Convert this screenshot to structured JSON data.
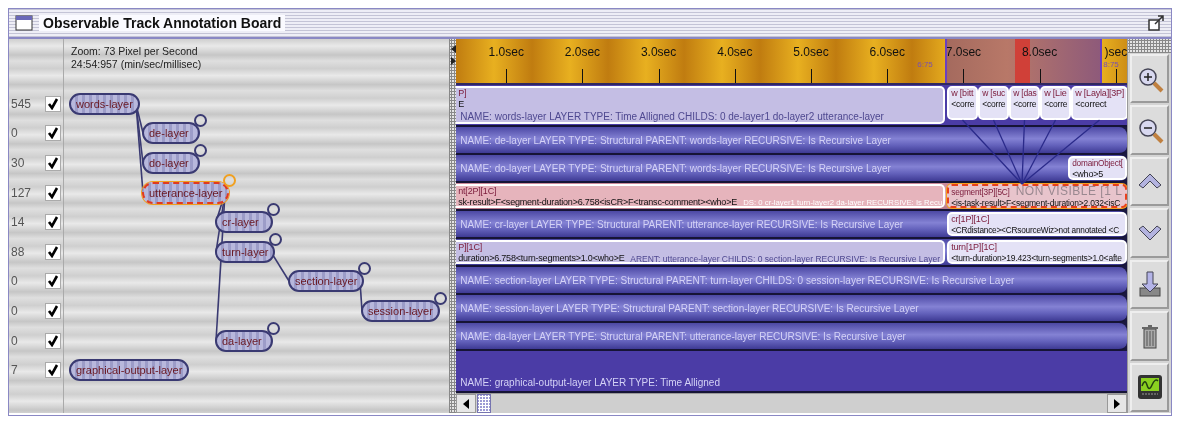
{
  "window": {
    "title": "Observable Track Annotation Board"
  },
  "zoom": {
    "scale": "Zoom: 73 Pixel per Second",
    "time": "24:54:957 (min/sec/millisec)"
  },
  "ruler": {
    "ticks": [
      "1.0sec",
      "2.0sec",
      "3.0sec",
      "4.0sec",
      "5.0sec",
      "6.0sec",
      "7.0sec",
      "8.0sec",
      ")sec"
    ],
    "markers": [
      {
        "label": "6:75"
      },
      {
        "label": "8:75"
      }
    ]
  },
  "layers": [
    {
      "label": "words-layer",
      "count": "545",
      "checked": true,
      "selected": false,
      "recursive": false,
      "kind": "time-aligned",
      "description": "NAME: words-layer LAYER TYPE: Time Alligned CHILDS: 0 de-layer1 do-layer2 utterance-layer",
      "annotations": [
        {
          "lines": [
            "P]",
            "E"
          ],
          "selected": false
        },
        {
          "lines": [
            "w [bitt",
            "<corre"
          ],
          "selected": false
        },
        {
          "lines": [
            "w [suc",
            "<corre"
          ],
          "selected": false
        },
        {
          "lines": [
            "w [das",
            "<corre"
          ],
          "selected": false
        },
        {
          "lines": [
            "w [Lie",
            "<corre"
          ],
          "selected": false
        },
        {
          "lines": [
            "w [Layla][3P]",
            "<correct"
          ],
          "selected": false
        }
      ],
      "children": [
        {
          "label": "de-layer",
          "count": "0",
          "checked": true,
          "selected": false,
          "recursive": true,
          "kind": "structural",
          "description": "NAME: de-layer LAYER TYPE: Structural PARENT: words-layer RECURSIVE: Is Recursive Layer"
        },
        {
          "label": "do-layer",
          "count": "30",
          "checked": true,
          "selected": false,
          "recursive": true,
          "kind": "structural",
          "description": "NAME: do-layer LAYER TYPE: Structural PARENT: words-layer RECURSIVE: Is Recursive Layer",
          "annotations": [
            {
              "lines": [
                "domainObject[",
                "<who>5"
              ],
              "selected": false
            }
          ]
        },
        {
          "label": "utterance-layer",
          "count": "127",
          "checked": true,
          "selected": true,
          "recursive": true,
          "kind": "structural",
          "description": "DS: 0 cr-layer1 turn-layer2 da-layer RECURSIVE: Is Recu",
          "annotations": [
            {
              "lines": [
                "nt[2P][1C]",
                "sk-result>F<segment-duration>6.758<isCR>F<transc-comment><who>E"
              ],
              "selected": false
            },
            {
              "lines": [
                "segment[3P][5C]",
                "<is-task-result>F<segment-duration>2.032<isC"
              ],
              "note": "NON VISIBLE [1 L",
              "selected": true
            }
          ],
          "children": [
            {
              "label": "cr-layer",
              "count": "14",
              "checked": true,
              "selected": false,
              "recursive": true,
              "kind": "structural",
              "description": "NAME: cr-layer LAYER TYPE: Structural PARENT: utterance-layer RECURSIVE: Is Recursive Layer",
              "annotations": [
                {
                  "lines": [
                    "cr[1P][1C]",
                    "<CRdistance><CRsourceWiz>not annotated <C"
                  ],
                  "selected": false
                }
              ]
            },
            {
              "label": "turn-layer",
              "count": "88",
              "checked": true,
              "selected": false,
              "recursive": true,
              "kind": "structural",
              "description": "ARENT: utterance-layer CHILDS: 0 section-layer RECURSIVE: Is Recursive Layer",
              "annotations": [
                {
                  "lines": [
                    "P][1C]",
                    "duration>6.758<turn-segments>1.0<who>E"
                  ],
                  "selected": false
                },
                {
                  "lines": [
                    "turn[1P][1C]",
                    "<turn-duration>19.423<turn-segments>1.0<afte"
                  ],
                  "selected": false
                }
              ],
              "children": [
                {
                  "label": "section-layer",
                  "count": "0",
                  "checked": true,
                  "selected": false,
                  "recursive": true,
                  "kind": "structural",
                  "description": "NAME: section-layer LAYER TYPE: Structural PARENT: turn-layer CHILDS: 0 session-layer RECURSIVE: Is Recursive Layer",
                  "children": [
                    {
                      "label": "session-layer",
                      "count": "0",
                      "checked": true,
                      "selected": false,
                      "recursive": true,
                      "kind": "structural",
                      "description": "NAME: session-layer LAYER TYPE: Structural PARENT: section-layer RECURSIVE: Is Recursive Layer"
                    }
                  ]
                }
              ]
            },
            {
              "label": "da-layer",
              "count": "0",
              "checked": true,
              "selected": false,
              "recursive": true,
              "kind": "structural",
              "description": "NAME: da-layer LAYER TYPE: Structural PARENT: utterance-layer RECURSIVE: Is Recursive Layer"
            }
          ]
        }
      ]
    },
    {
      "label": "graphical-output-layer",
      "count": "7",
      "checked": true,
      "selected": false,
      "recursive": false,
      "kind": "time-aligned",
      "description": "NAME: graphical-output-layer LAYER TYPE: Time Alligned"
    }
  ]
}
